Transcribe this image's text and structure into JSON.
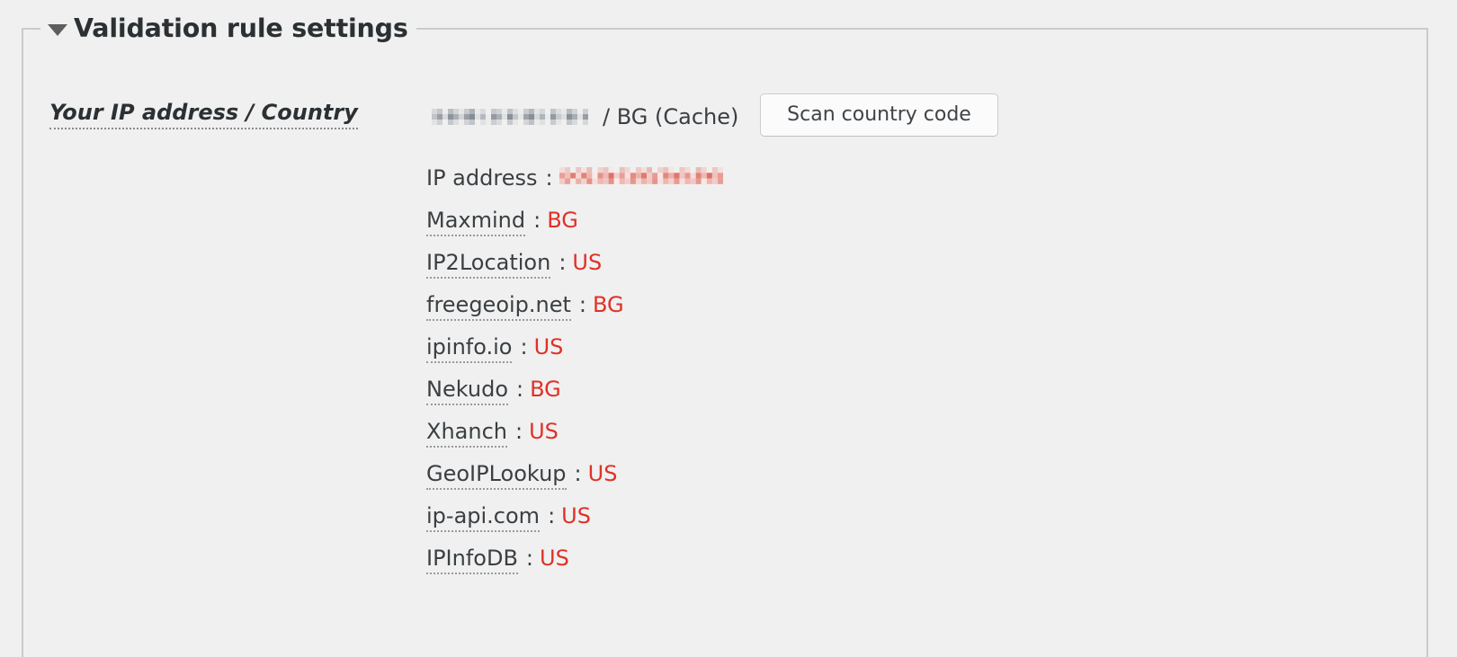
{
  "panel": {
    "legend": "Validation rule settings",
    "toggle_icon": "triangle-down-icon",
    "expanded": true,
    "border_color": "#cbcbcb",
    "background_color": "#f0f0f0"
  },
  "field": {
    "label": "Your IP address / Country",
    "ip_value": "[redacted]",
    "ip_redacted": true,
    "separator": "/",
    "country": "BG",
    "source": "(Cache)",
    "value_text": "/ BG (Cache)",
    "scan_button_label": "Scan country code"
  },
  "results": {
    "ip_label": "IP address",
    "ip_value": "[redacted]",
    "ip_redacted": true,
    "separator": ":",
    "providers": [
      {
        "name": "Maxmind",
        "country": "BG"
      },
      {
        "name": "IP2Location",
        "country": "US"
      },
      {
        "name": "freegeoip.net",
        "country": "BG"
      },
      {
        "name": "ipinfo.io",
        "country": "US"
      },
      {
        "name": "Nekudo",
        "country": "BG"
      },
      {
        "name": "Xhanch",
        "country": "US"
      },
      {
        "name": "GeoIPLookup",
        "country": "US"
      },
      {
        "name": "ip-api.com",
        "country": "US"
      },
      {
        "name": "IPInfoDB",
        "country": "US"
      }
    ]
  },
  "colors": {
    "country_code": "#e03127",
    "text": "#3a3f42",
    "heading": "#2b3033",
    "border": "#cbcbcb",
    "background": "#f0f0f0",
    "button_face": "#fbfbfb"
  }
}
